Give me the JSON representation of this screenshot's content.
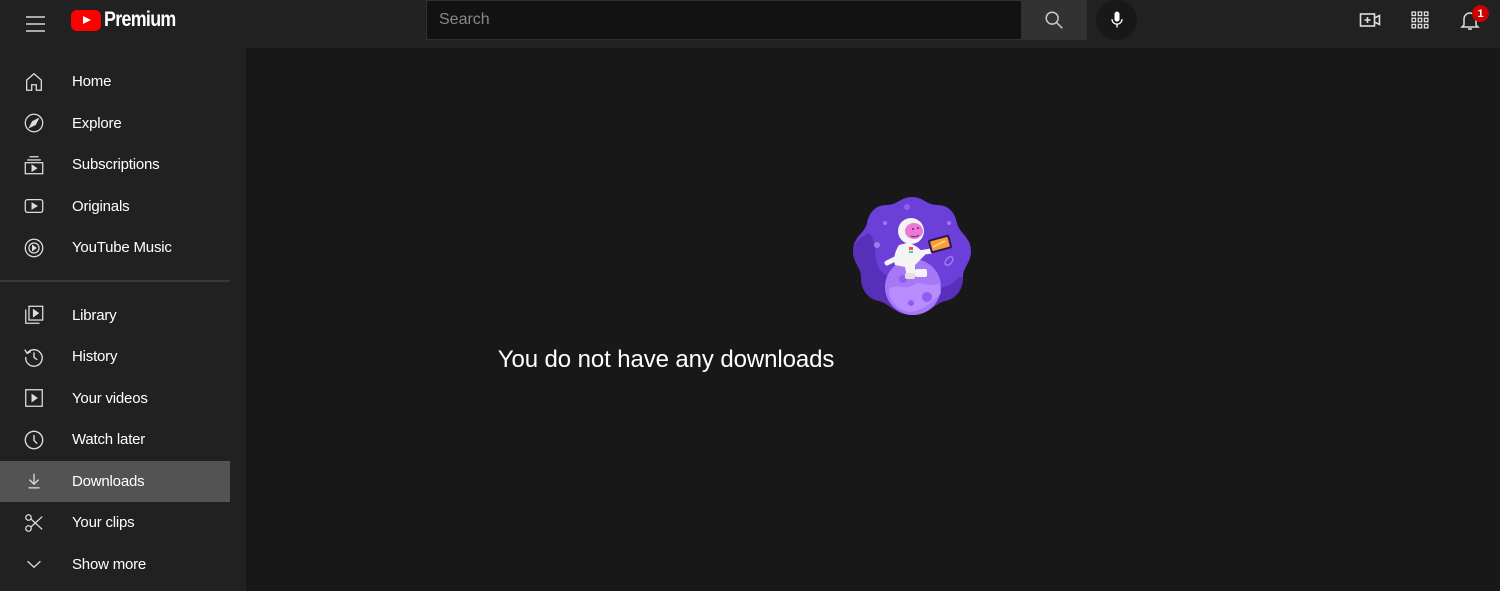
{
  "header": {
    "brand_label": "Premium",
    "search": {
      "placeholder": "Search",
      "value": ""
    },
    "notification_count": "1",
    "icons": {
      "menu": "hamburger-icon",
      "logo": "youtube-logo",
      "search": "search-icon",
      "mic": "microphone-icon",
      "create": "create-video-icon",
      "apps": "apps-grid-icon",
      "notifications": "bell-icon"
    }
  },
  "sidebar": {
    "section_primary": [
      {
        "label": "Home",
        "icon": "home-icon"
      },
      {
        "label": "Explore",
        "icon": "compass-icon"
      },
      {
        "label": "Subscriptions",
        "icon": "subscriptions-icon"
      },
      {
        "label": "Originals",
        "icon": "originals-icon"
      },
      {
        "label": "YouTube Music",
        "icon": "music-icon"
      }
    ],
    "section_library": [
      {
        "label": "Library",
        "icon": "library-icon"
      },
      {
        "label": "History",
        "icon": "history-icon"
      },
      {
        "label": "Your videos",
        "icon": "your-videos-icon"
      },
      {
        "label": "Watch later",
        "icon": "clock-icon"
      },
      {
        "label": "Downloads",
        "icon": "download-icon",
        "active": true
      },
      {
        "label": "Your clips",
        "icon": "scissors-icon"
      },
      {
        "label": "Show more",
        "icon": "chevron-down-icon"
      }
    ]
  },
  "main": {
    "empty_message": "You do not have any downloads",
    "illustration": "astronaut-on-planet-illustration"
  },
  "colors": {
    "brand_red": "#ff0000",
    "badge_red": "#cc0000",
    "active_item_bg": "#535353",
    "illustration_purple": "#6c3fd6"
  }
}
